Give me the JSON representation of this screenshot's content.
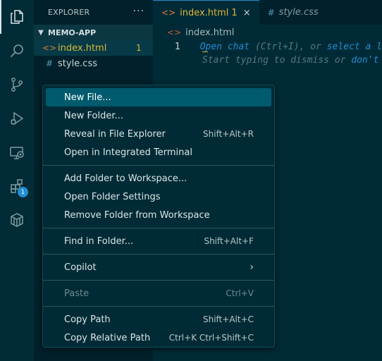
{
  "activity_bar": {
    "items": [
      {
        "name": "explorer-icon",
        "active": true
      },
      {
        "name": "search-icon"
      },
      {
        "name": "source-control-icon"
      },
      {
        "name": "run-debug-icon"
      },
      {
        "name": "remote-explorer-icon"
      },
      {
        "name": "extensions-icon",
        "badge": "1"
      },
      {
        "name": "containers-icon"
      }
    ]
  },
  "sidebar": {
    "title": "EXPLORER",
    "more": "···",
    "section": "MEMO-APP",
    "files": [
      {
        "icon": "<>",
        "name": "index.html",
        "count": "1",
        "selected": true,
        "color": "#d7b838",
        "icon_color": "#e37933"
      },
      {
        "icon": "#",
        "name": "style.css",
        "count": "",
        "selected": false,
        "color": "#c8d6d9",
        "icon_color": "#519aba"
      }
    ]
  },
  "tabs": [
    {
      "icon": "<>",
      "label": "index.html",
      "problems": "1",
      "close": "×",
      "active": true
    },
    {
      "icon": "#",
      "label": "style.css",
      "active": false
    }
  ],
  "breadcrumb": {
    "icon": "<>",
    "file": "index.html"
  },
  "editor": {
    "lines": [
      {
        "number": "1",
        "parts": [
          {
            "text": "Open chat",
            "hl": true
          },
          {
            "text": " (Ctrl+I), or ",
            "hl": false
          },
          {
            "text": "select a l",
            "hl": true
          }
        ]
      },
      {
        "number": "",
        "parts": [
          {
            "text": "Start typing to dismiss or ",
            "hl": false
          },
          {
            "text": "don't",
            "hl": true
          }
        ]
      }
    ]
  },
  "context_menu": {
    "groups": [
      [
        {
          "label": "New File...",
          "shortcut": "",
          "active": true
        },
        {
          "label": "New Folder...",
          "shortcut": ""
        },
        {
          "label": "Reveal in File Explorer",
          "shortcut": "Shift+Alt+R"
        },
        {
          "label": "Open in Integrated Terminal",
          "shortcut": ""
        }
      ],
      [
        {
          "label": "Add Folder to Workspace...",
          "shortcut": ""
        },
        {
          "label": "Open Folder Settings",
          "shortcut": ""
        },
        {
          "label": "Remove Folder from Workspace",
          "shortcut": ""
        }
      ],
      [
        {
          "label": "Find in Folder...",
          "shortcut": "Shift+Alt+F"
        }
      ],
      [
        {
          "label": "Copilot",
          "shortcut": "",
          "submenu": true
        }
      ],
      [
        {
          "label": "Paste",
          "shortcut": "Ctrl+V",
          "disabled": true
        }
      ],
      [
        {
          "label": "Copy Path",
          "shortcut": "Shift+Alt+C"
        },
        {
          "label": "Copy Relative Path",
          "shortcut": "Ctrl+K Ctrl+Shift+C"
        }
      ]
    ]
  },
  "colors": {
    "accent": "#268bd2",
    "editor_bg": "#002b36",
    "sidebar_bg": "#00212b",
    "menu_active": "#005a6e",
    "modified": "#d7b838"
  }
}
